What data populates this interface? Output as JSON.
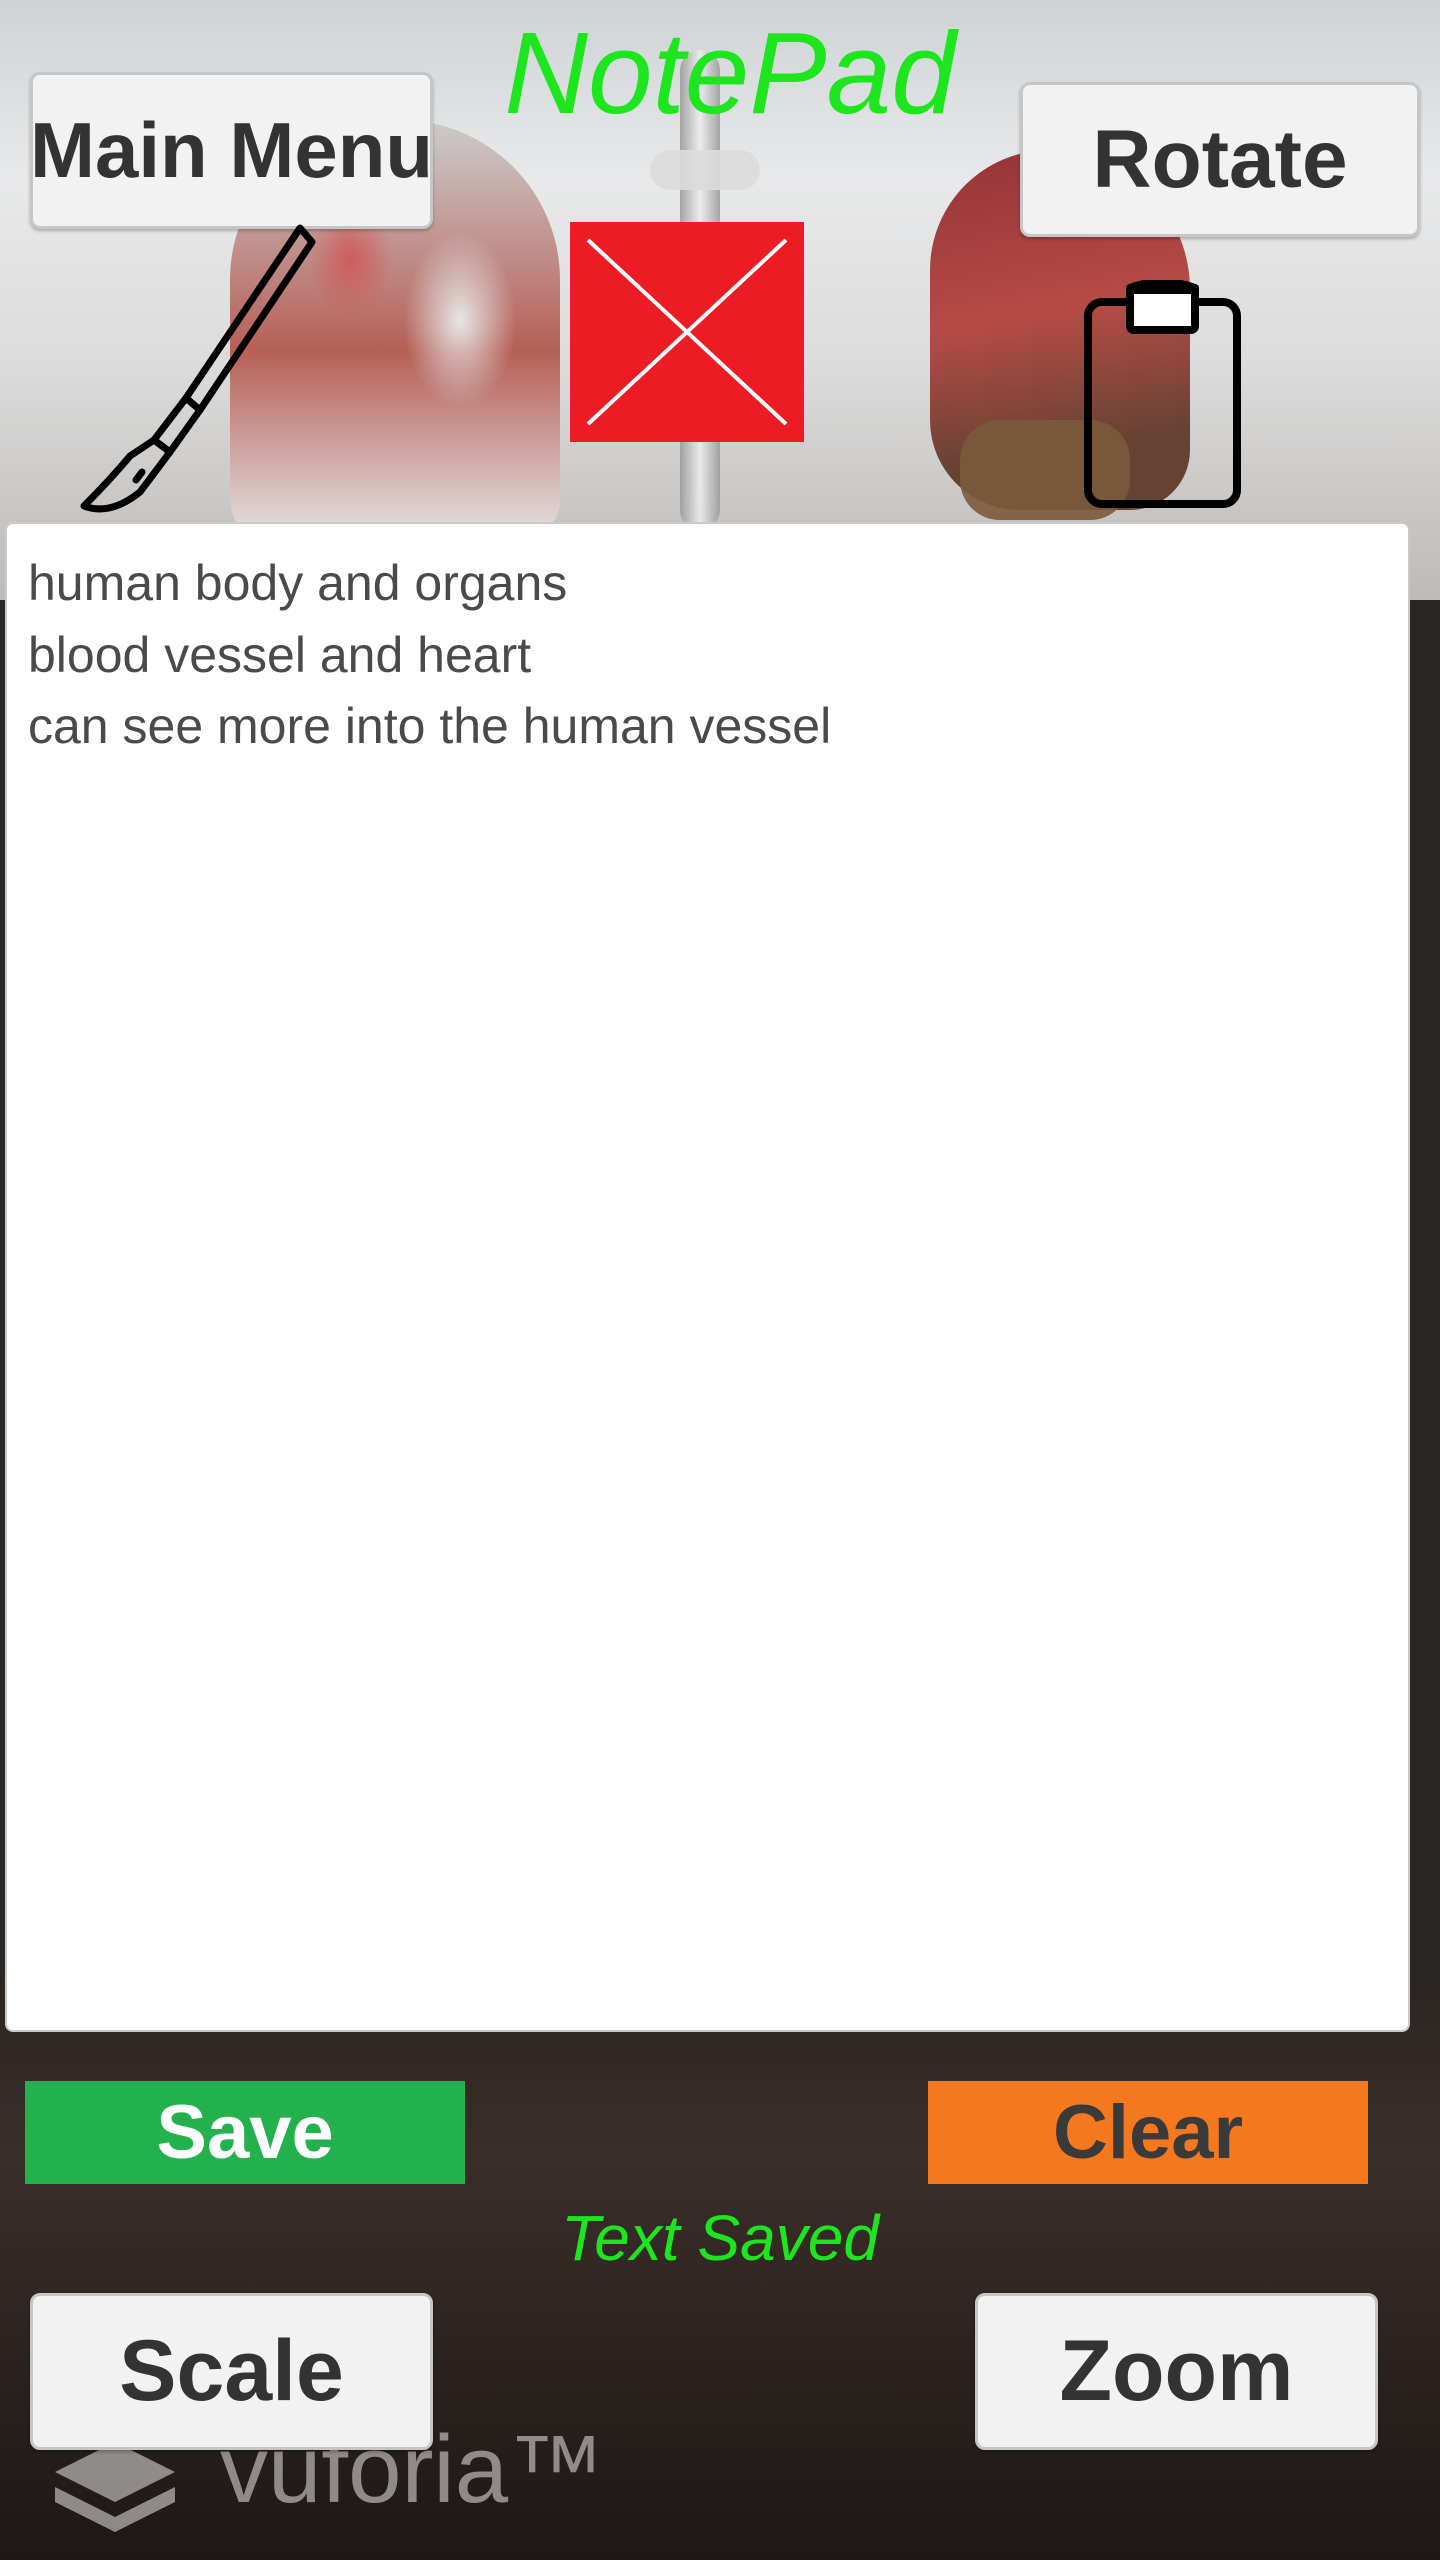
{
  "app": {
    "title": "NotePad",
    "title_color": "#1ee61e"
  },
  "toolbar": {
    "main_menu_label": "Main Menu",
    "rotate_label": "Rotate",
    "scale_label": "Scale",
    "zoom_label": "Zoom"
  },
  "icons": {
    "scalpel": "scalpel-icon",
    "close": "close-icon",
    "clipboard": "clipboard-icon"
  },
  "notepad": {
    "lines": [
      "human body and organs",
      "blood vessel and heart",
      "can see more into the human vessel"
    ]
  },
  "actions": {
    "save_label": "Save",
    "save_color": "#22b14c",
    "clear_label": "Clear",
    "clear_color": "#f5781e"
  },
  "status": {
    "message": "Text Saved"
  },
  "watermark": {
    "text": "vuforia™"
  }
}
